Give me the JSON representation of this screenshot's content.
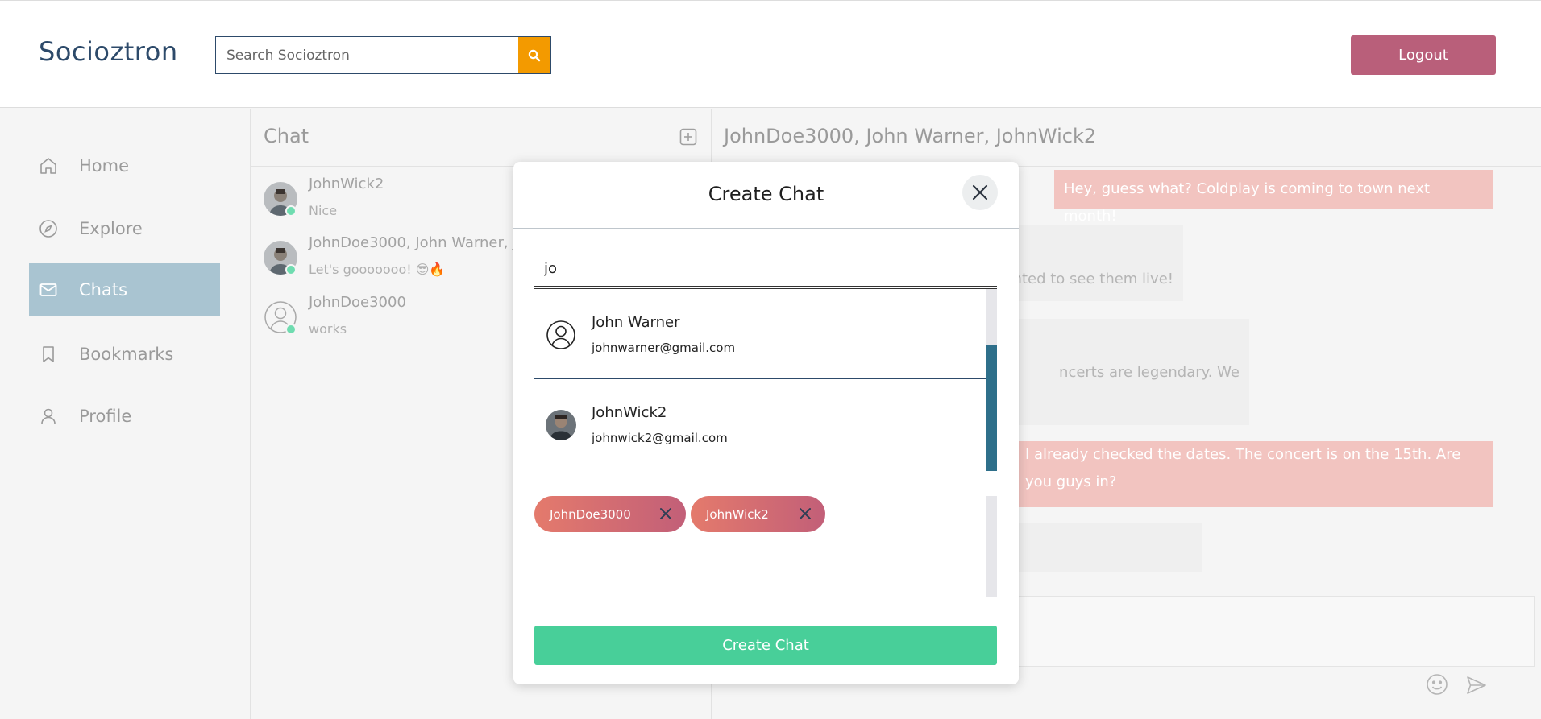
{
  "header": {
    "logo": "Socioztron",
    "search_placeholder": "Search Socioztron",
    "logout_label": "Logout"
  },
  "sidebar": {
    "items": [
      {
        "label": "Home",
        "icon": "home-icon"
      },
      {
        "label": "Explore",
        "icon": "compass-icon"
      },
      {
        "label": "Chats",
        "icon": "mail-icon",
        "active": true
      },
      {
        "label": "Bookmarks",
        "icon": "bookmark-icon"
      },
      {
        "label": "Profile",
        "icon": "user-icon"
      }
    ]
  },
  "chat_list": {
    "title": "Chat",
    "chats": [
      {
        "name": "JohnWick2",
        "preview": "Nice",
        "online": true
      },
      {
        "name": "JohnDoe3000, John Warner, J",
        "preview": "Let's gooooooo! 😎🔥",
        "online": true
      },
      {
        "name": "JohnDoe3000",
        "preview": "works",
        "online": true
      }
    ]
  },
  "conversation": {
    "title": "JohnDoe3000, John Warner, JohnWick2",
    "messages": [
      {
        "text": "Hey, guess what? Coldplay is coming to town next month!",
        "mine": true
      },
      {
        "text": "nted to see them live!",
        "mine": false
      },
      {
        "text": "ncerts are legendary. We",
        "mine": false
      },
      {
        "text_line1": "I already checked the dates. The concert is on the 15th. Are",
        "text_line2": "you guys in?",
        "mine": true
      }
    ]
  },
  "modal": {
    "title": "Create Chat",
    "search_value": "jo",
    "results": [
      {
        "name": "John Warner",
        "email": "johnwarner@gmail.com",
        "avatar": "default-user-icon"
      },
      {
        "name": "JohnWick2",
        "email": "johnwick2@gmail.com",
        "avatar": "photo"
      }
    ],
    "selected": [
      {
        "name": "JohnDoe3000"
      },
      {
        "name": "JohnWick2"
      }
    ],
    "create_label": "Create Chat"
  },
  "colors": {
    "brand": "#2d4a6a",
    "search_button": "#f39a00",
    "logout": "#b95f7a",
    "sidebar_active": "#a9c4d1",
    "create_button": "#48cf99",
    "online": "#6fdcb0"
  }
}
